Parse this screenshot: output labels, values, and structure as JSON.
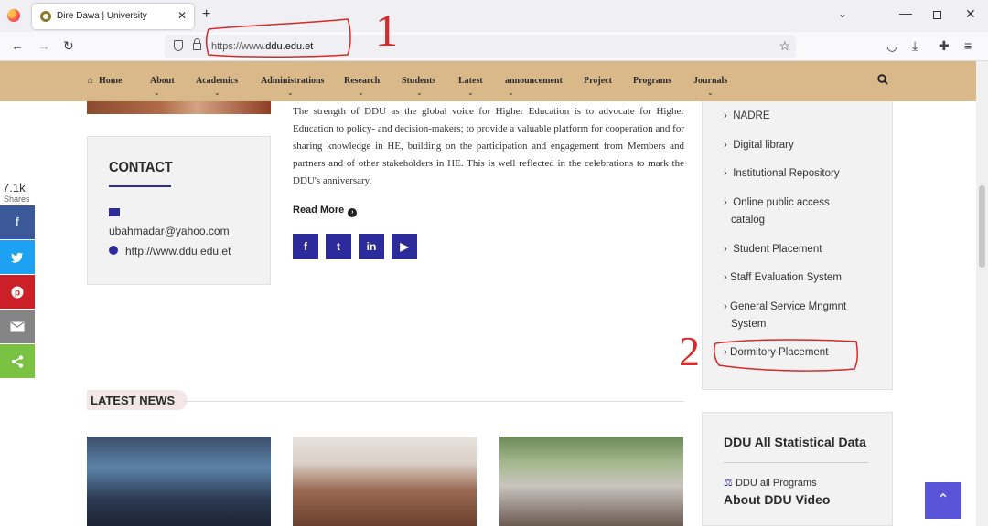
{
  "browser": {
    "tab_title": "Dire Dawa | University",
    "tab_close": "✕",
    "new_tab": "+",
    "url_prefix": "https://www.",
    "url_domain": "ddu.edu.et",
    "window": {
      "minimize": "—",
      "close": "✕",
      "tabs_dropdown": "⌄"
    },
    "icons": {
      "back": "←",
      "forward": "→",
      "reload": "↻",
      "star": "☆",
      "pocket": "◡",
      "downloads": "⤓",
      "extensions": "✚",
      "menu": "≡"
    }
  },
  "annotations": {
    "mark_1": "1",
    "mark_2": "2"
  },
  "menu": {
    "home": "Home",
    "items": [
      "About",
      "Academics",
      "Administrations",
      "Research",
      "Students",
      "Latest",
      "announcement",
      "Project",
      "Programs",
      "Journals"
    ]
  },
  "contact": {
    "title": "CONTACT",
    "email": "ubahmadar@yahoo.com",
    "website": "http://www.ddu.edu.et"
  },
  "article": {
    "text": "The strength of DDU as the global voice for Higher Education is to advocate for Higher Education to policy- and decision-makers; to provide a valuable platform for cooperation and for sharing knowledge in HE, building on the participation and engagement from Members and partners and of other stakeholders in HE. This is well reflected in the celebrations to mark the DDU's anniversary.",
    "read_more": "Read More"
  },
  "social": {
    "facebook": "f",
    "twitter": "t",
    "linkedin": "in",
    "youtube": "▶"
  },
  "share_bar": {
    "count": "7.1k",
    "label": "Shares",
    "colors": {
      "facebook": "#3b5998",
      "twitter": "#1da1f2",
      "pinterest": "#cb2027",
      "email": "#848484",
      "share": "#7bc242"
    }
  },
  "sidebar": {
    "links": [
      "NADRE",
      "Digital library",
      "Institutional Repository",
      "Online public access",
      "catalog",
      "Student Placement",
      "Staff Evaluation System",
      "General Service Mngmnt",
      "System",
      "Dormitory Placement"
    ]
  },
  "latest_news": {
    "title": "LATEST NEWS"
  },
  "stats": {
    "title": "DDU All Statistical Data",
    "programs": "DDU all Programs",
    "video": "About DDU Video"
  },
  "colors": {
    "accent": "#2d2a9b",
    "menu_bg": "#d9b98a",
    "annotation": "#d42a2a"
  }
}
